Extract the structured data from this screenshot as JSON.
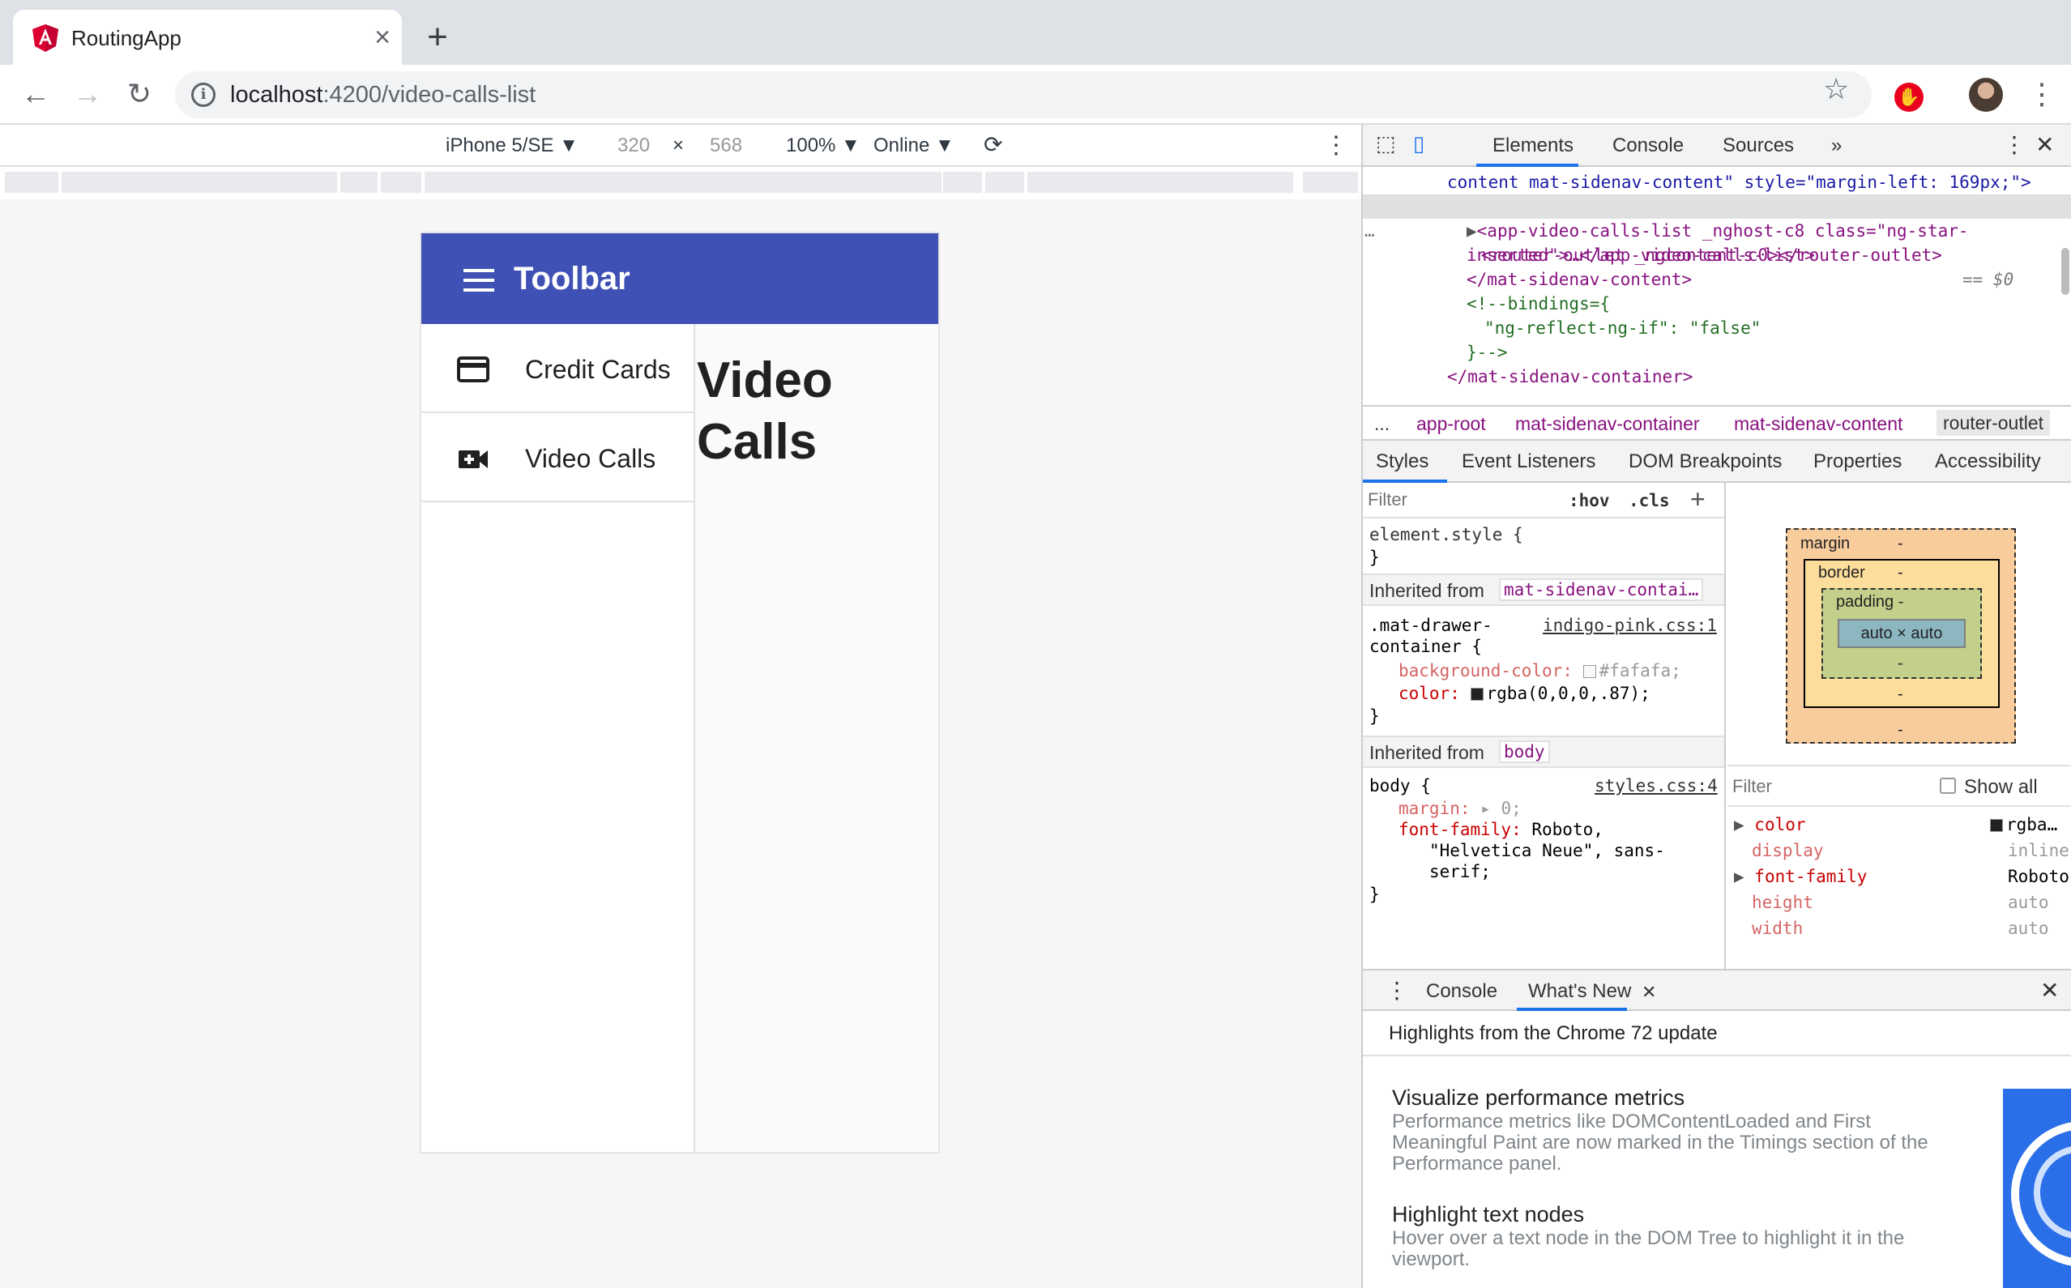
{
  "browser": {
    "tab_title": "RoutingApp",
    "tab_close": "×",
    "new_tab": "+",
    "url_host": "localhost",
    "url_path": ":4200/video-calls-list"
  },
  "device_toolbar": {
    "device": "iPhone 5/SE ▼",
    "width": "320",
    "times": "×",
    "height": "568",
    "zoom": "100% ▼",
    "network": "Online ▼"
  },
  "app": {
    "toolbar_title": "Toolbar",
    "nav_items": [
      {
        "label": "Credit Cards",
        "icon": "credit-card-icon"
      },
      {
        "label": "Video Calls",
        "icon": "video-camera-icon"
      }
    ],
    "page_heading": "Video Calls",
    "colors": {
      "primary": "#3f51b5"
    }
  },
  "devtools": {
    "tabs": [
      "Elements",
      "Console",
      "Sources",
      "»"
    ],
    "dom_lines": [
      "content mat-sidenav-content\" style=\"margin-left: 169px;\">",
      "<router-outlet _ngcontent-c0></router-outlet>",
      "== $0",
      "<app-video-calls-list _nghost-c8 class=\"ng-star-",
      "inserted\">…</app-video-calls-list>",
      "</mat-sidenav-content>",
      "<!--bindings={",
      "\"ng-reflect-ng-if\": \"false\"",
      "}-->",
      "</mat-sidenav-container>"
    ],
    "breadcrumbs": [
      "...",
      "app-root",
      "mat-sidenav-container",
      "mat-sidenav-content",
      "router-outlet"
    ],
    "subtabs": [
      "Styles",
      "Event Listeners",
      "DOM Breakpoints",
      "Properties",
      "Accessibility"
    ],
    "styles": {
      "filter_placeholder": "Filter",
      "hov": ":hov",
      "cls": ".cls",
      "element_style": "element.style {",
      "close_brace": "}",
      "inherited_label": "Inherited from",
      "inherited_1": "mat-sidenav-contai…",
      "rule1_selector_a": ".mat-drawer-",
      "rule1_selector_b": "container {",
      "rule1_source": "indigo-pink.css:1",
      "rule1_prop1": "background-color:",
      "rule1_val1": "#fafafa;",
      "rule1_prop2": "color:",
      "rule1_val2": "rgba(0,0,0,.87);",
      "inherited_2": "body",
      "rule2_selector": "body {",
      "rule2_source": "styles.css:4",
      "rule2_prop1": "margin:",
      "rule2_val1": "0;",
      "rule2_prop2": "font-family:",
      "rule2_val2a": "Roboto,",
      "rule2_val2b": "\"Helvetica Neue\", sans-",
      "rule2_val2c": "serif;"
    },
    "box_model": {
      "margin": "margin",
      "border": "border",
      "padding": "padding -",
      "content": "auto × auto",
      "dash": "-"
    },
    "computed": {
      "filter_placeholder": "Filter",
      "show_all": "Show all",
      "rows": [
        {
          "prop": "color",
          "value": "rgba…"
        },
        {
          "prop": "display",
          "value": "inline"
        },
        {
          "prop": "font-family",
          "value": "Roboto,…"
        },
        {
          "prop": "height",
          "value": "auto"
        },
        {
          "prop": "width",
          "value": "auto"
        }
      ]
    },
    "drawer": {
      "tabs": [
        "Console",
        "What's New"
      ],
      "header": "Highlights from the Chrome 72 update",
      "items": [
        {
          "title": "Visualize performance metrics",
          "body": "Performance metrics like DOMContentLoaded and First Meaningful Paint are now marked in the Timings section of the Performance panel."
        },
        {
          "title": "Highlight text nodes",
          "body": "Hover over a text node in the DOM Tree to highlight it in the viewport."
        }
      ]
    }
  }
}
